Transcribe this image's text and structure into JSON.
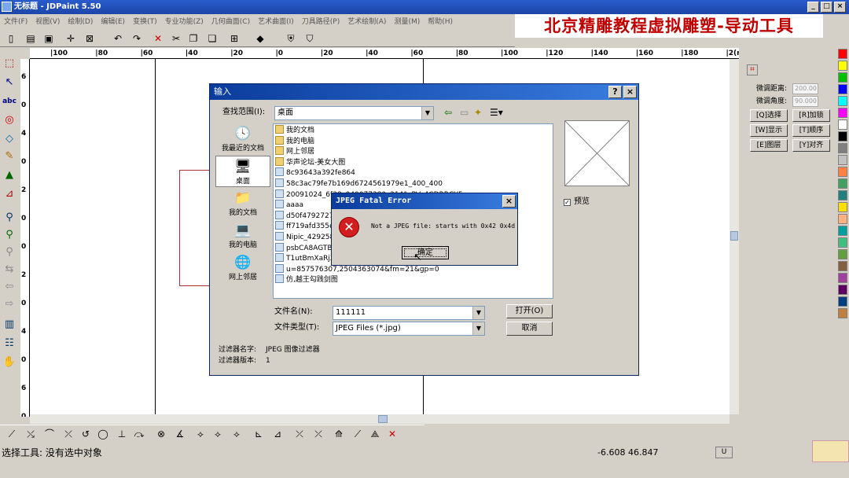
{
  "app": {
    "title": "无标题 - JDPaint 5.50",
    "banner": "北京精雕教程虚拟雕塑-导动工具",
    "menu": [
      "文件(F)",
      "视图(V)",
      "绘制(D)",
      "编辑(E)",
      "变换(T)",
      "专业功能(Z)",
      "几何曲面(C)",
      "艺术曲面(I)",
      "刀具路径(P)",
      "艺术绘制(A)",
      "测量(M)",
      "帮助(H)"
    ]
  },
  "ruler": {
    "h_labels": [
      "100",
      "80",
      "60",
      "40",
      "20",
      "0",
      "20",
      "40",
      "60",
      "80",
      "100",
      "120",
      "140",
      "160",
      "180",
      "2(mm"
    ],
    "v_labels": [
      "6",
      "0",
      "4",
      "0",
      "2",
      "0",
      "0",
      "2",
      "0",
      "4",
      "0",
      "6",
      "0"
    ]
  },
  "right_panel": {
    "fine_dist_label": "微调距离:",
    "fine_dist_value": "200.00",
    "fine_angle_label": "微调角度:",
    "fine_angle_value": "90.000",
    "buttons": [
      "[Q]选择",
      "[R]加锁",
      "[W]显示",
      "[T]顺序",
      "[E]图层",
      "[Y]对齐"
    ]
  },
  "palette": [
    "#ff0000",
    "#ffff00",
    "#00c000",
    "#0000ff",
    "#00ffff",
    "#ff00ff",
    "#ffffff",
    "#000000",
    "#808080",
    "#c0c0c0",
    "#ff8040",
    "#40a060",
    "#208080",
    "#ffe000",
    "#ffb080",
    "#00a0a0",
    "#40c080",
    "#60a040",
    "#806040",
    "#a040a0",
    "#600060",
    "#004080",
    "#c08040"
  ],
  "status": {
    "text": "选择工具: 没有选中对象",
    "coords": "-6.608 46.847",
    "unit": "U"
  },
  "dialog": {
    "title": "输入",
    "look_in_label": "查找范围(I):",
    "look_in_value": "桌面",
    "places": [
      "我最近的文档",
      "桌面",
      "我的文档",
      "我的电脑",
      "网上邻居"
    ],
    "files": [
      {
        "name": "我的文档",
        "type": "folder"
      },
      {
        "name": "我的电脑",
        "type": "folder"
      },
      {
        "name": "网上邻居",
        "type": "folder"
      },
      {
        "name": "华声论坛-美女大图",
        "type": "folder"
      },
      {
        "name": "8c93643a392fe864",
        "type": "img"
      },
      {
        "name": "58c3ac79fe7b169d6724561979e1_400_400",
        "type": "img"
      },
      {
        "name": "20091024_6f38c040077280c2141_PV_4CDRRGY5",
        "type": "img"
      },
      {
        "name": "aaaa",
        "type": "img"
      },
      {
        "name": "d50f47927275",
        "type": "img"
      },
      {
        "name": "ff719afd355e",
        "type": "img"
      },
      {
        "name": "Nipic_429258",
        "type": "img"
      },
      {
        "name": "psbCA8AGTBY",
        "type": "img"
      },
      {
        "name": "T1utBmXaRjXX",
        "type": "img"
      },
      {
        "name": "u=857576307,2504363074&fm=21&gp=0",
        "type": "img"
      },
      {
        "name": "仿,越王勾践剑图",
        "type": "img"
      }
    ],
    "filename_label": "文件名(N):",
    "filename_value": "111111",
    "filetype_label": "文件类型(T):",
    "filetype_value": "JPEG Files (*.jpg)",
    "open_button": "打开(O)",
    "cancel_button": "取消",
    "preview_label": "预览",
    "filter_name_label": "过滤器名字:",
    "filter_name_value": "JPEG 图像过滤器",
    "filter_version_label": "过滤器版本:",
    "filter_version_value": "1"
  },
  "error": {
    "title": "JPEG Fatal Error",
    "message": "Not a JPEG file: starts with 0x42 0x4d",
    "ok_button": "确定"
  }
}
